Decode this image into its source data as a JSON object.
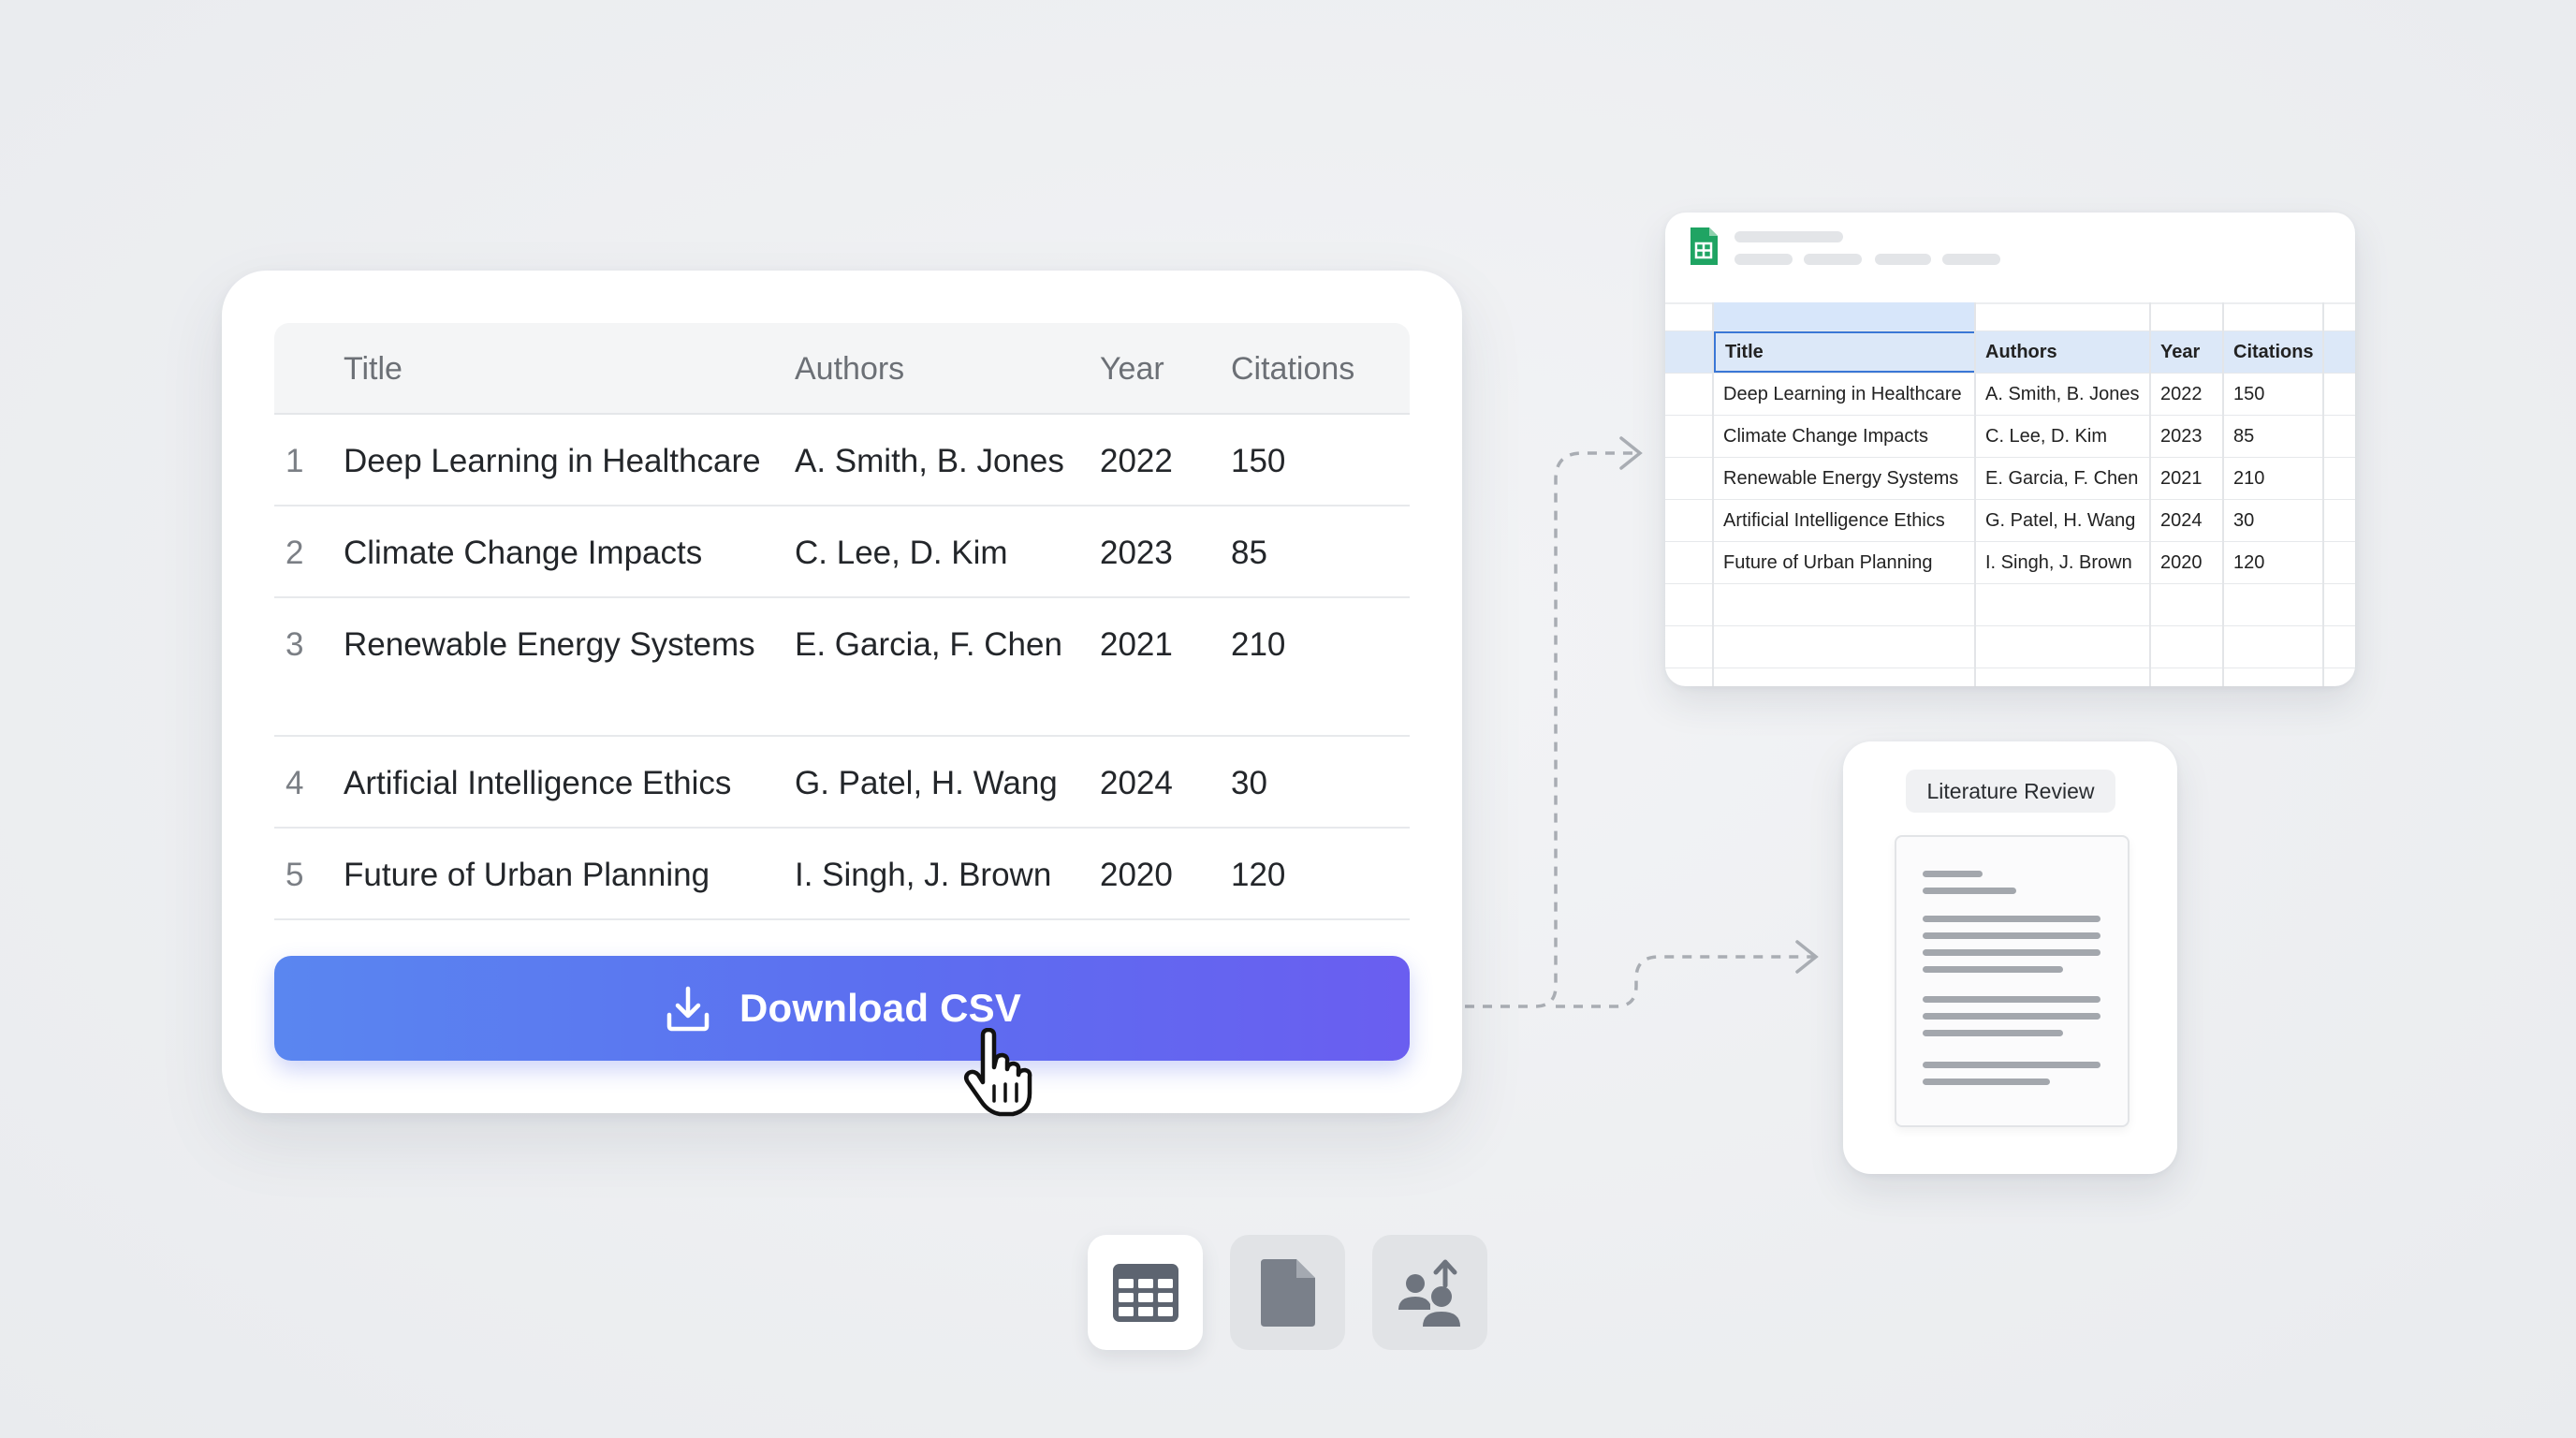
{
  "main_table": {
    "headers": {
      "title": "Title",
      "authors": "Authors",
      "year": "Year",
      "citations": "Citations"
    },
    "rows": [
      {
        "num": "1",
        "title": "Deep Learning in Healthcare",
        "authors": "A. Smith, B. Jones",
        "year": "2022",
        "citations": "150"
      },
      {
        "num": "2",
        "title": "Climate Change Impacts",
        "authors": "C. Lee, D. Kim",
        "year": "2023",
        "citations": "85"
      },
      {
        "num": "3",
        "title": "Renewable Energy Systems",
        "authors": "E. Garcia, F. Chen",
        "year": "2021",
        "citations": "210"
      },
      {
        "num": "4",
        "title": "Artificial Intelligence Ethics",
        "authors": "G. Patel, H. Wang",
        "year": "2024",
        "citations": "30"
      },
      {
        "num": "5",
        "title": "Future of Urban Planning",
        "authors": "I. Singh, J. Brown",
        "year": "2020",
        "citations": "120"
      }
    ]
  },
  "download_button": {
    "label": "Download CSV",
    "icon": "download-icon"
  },
  "spreadsheet": {
    "app_icon": "sheets-icon",
    "headers": {
      "title": "Title",
      "authors": "Authors",
      "year": "Year",
      "citations": "Citations"
    },
    "rows": [
      {
        "title": "Deep Learning in Healthcare",
        "authors": "A. Smith, B. Jones",
        "year": "2022",
        "citations": "150"
      },
      {
        "title": "Climate Change Impacts",
        "authors": "C. Lee, D. Kim",
        "year": "2023",
        "citations": "85"
      },
      {
        "title": "Renewable Energy Systems",
        "authors": "E. Garcia, F. Chen",
        "year": "2021",
        "citations": "210"
      },
      {
        "title": "Artificial Intelligence Ethics",
        "authors": "G. Patel, H. Wang",
        "year": "2024",
        "citations": "30"
      },
      {
        "title": "Future of Urban Planning",
        "authors": "I. Singh, J. Brown",
        "year": "2020",
        "citations": "120"
      }
    ]
  },
  "doc_card": {
    "title": "Literature Review",
    "icon": "document-icon"
  },
  "toolbar": [
    {
      "icon": "table-icon",
      "active": true
    },
    {
      "icon": "file-icon",
      "active": false
    },
    {
      "icon": "share-user-icon",
      "active": false
    }
  ],
  "colors": {
    "accent_start": "#5a86f0",
    "accent_end": "#6a5ef0",
    "sheets_green": "#1fa463",
    "selection": "#3a77d6"
  }
}
